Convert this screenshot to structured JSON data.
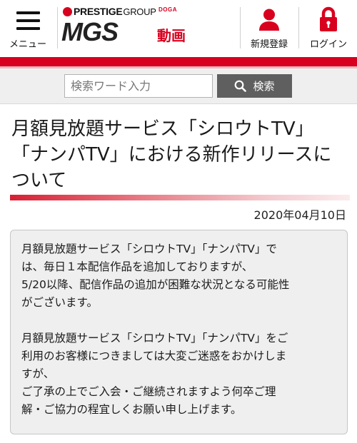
{
  "header": {
    "menu_label": "メニュー",
    "logo": {
      "prestige": "PRESTIGE",
      "group": "GROUP",
      "mgs": "MGS",
      "doga_small": "DOGA",
      "doga": "動画"
    },
    "register_label": "新規登録",
    "login_label": "ログイン",
    "accent_color": "#d8001f"
  },
  "search": {
    "placeholder": "検索ワード入力",
    "value": "",
    "button_label": "検索"
  },
  "article": {
    "title_lines": [
      "月額見放題サービス「シロウトTV」",
      "「ナンパTV」における新作リリースに",
      "ついて"
    ],
    "date": "2020年04月10日",
    "body_lines": [
      "月額見放題サービス「シロウトTV」「ナンパTV」で",
      "は、毎日１本配信作品を追加しておりますが、",
      "5/20以降、配信作品の追加が困難な状況となる可能性",
      "がございます。",
      "月額見放題サービス「シロウトTV」「ナンパTV」をご",
      "利用のお客様につきましては大変ご迷惑をおかけしま",
      "すが、",
      "ご了承の上でご入会・ご継続されますよう何卒ご理",
      "解・ご協力の程宜しくお願い申し上げます。"
    ]
  },
  "icons": {
    "menu": "hamburger-icon",
    "register": "user-icon",
    "login": "lock-icon",
    "search": "magnifier-icon"
  }
}
